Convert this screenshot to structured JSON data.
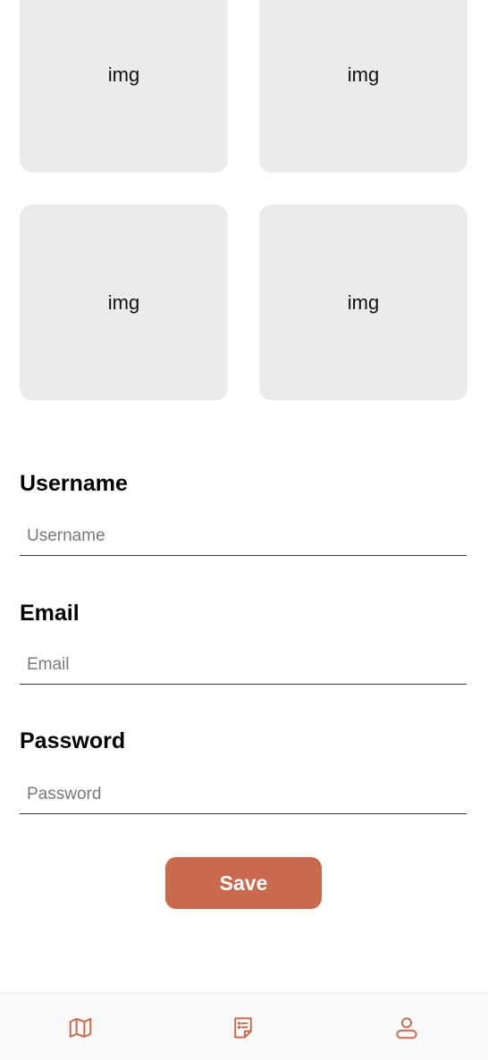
{
  "gallery": {
    "tiles": [
      {
        "label": "img"
      },
      {
        "label": "img"
      },
      {
        "label": "img"
      },
      {
        "label": "img"
      }
    ]
  },
  "form": {
    "username": {
      "label": "Username",
      "placeholder": "Username",
      "value": ""
    },
    "email": {
      "label": "Email",
      "placeholder": "Email",
      "value": ""
    },
    "password": {
      "label": "Password",
      "placeholder": "Password",
      "value": ""
    },
    "save_label": "Save"
  },
  "bottom_nav": {
    "items": [
      {
        "icon": "map-icon"
      },
      {
        "icon": "notes-icon"
      },
      {
        "icon": "profile-icon"
      }
    ]
  },
  "colors": {
    "accent": "#c96a4f",
    "tile_bg": "#ebebeb",
    "nav_bg": "#fafafa"
  }
}
